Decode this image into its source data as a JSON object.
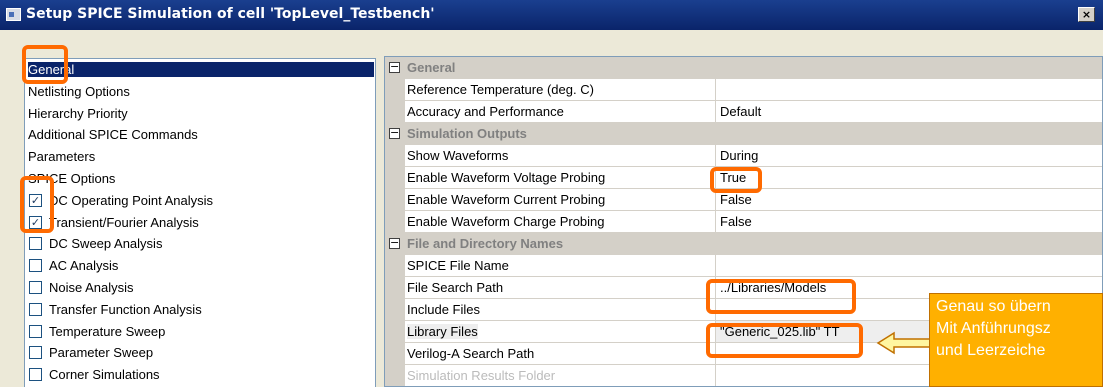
{
  "window": {
    "title": "Setup SPICE Simulation of cell 'TopLevel_Testbench'",
    "close_label": "×"
  },
  "nav": {
    "items": [
      {
        "label": "General",
        "selected": true
      },
      {
        "label": "Netlisting Options"
      },
      {
        "label": "Hierarchy Priority"
      },
      {
        "label": "Additional SPICE Commands"
      },
      {
        "label": "Parameters"
      },
      {
        "label": "SPICE Options"
      },
      {
        "label": "DC Operating Point Analysis",
        "checked": true
      },
      {
        "label": "Transient/Fourier Analysis",
        "checked": true
      },
      {
        "label": "DC Sweep Analysis",
        "checked": false
      },
      {
        "label": "AC Analysis",
        "checked": false
      },
      {
        "label": "Noise Analysis",
        "checked": false
      },
      {
        "label": "Transfer Function Analysis",
        "checked": false
      },
      {
        "label": "Temperature Sweep",
        "checked": false
      },
      {
        "label": "Parameter Sweep",
        "checked": false
      },
      {
        "label": "Corner Simulations",
        "checked": false
      }
    ]
  },
  "properties": {
    "rows": [
      {
        "type": "category",
        "name": "General"
      },
      {
        "type": "prop",
        "name": "Reference Temperature (deg. C)",
        "value": ""
      },
      {
        "type": "prop",
        "name": "Accuracy and Performance",
        "value": "Default"
      },
      {
        "type": "category",
        "name": "Simulation Outputs"
      },
      {
        "type": "prop",
        "name": "Show Waveforms",
        "value": "During"
      },
      {
        "type": "prop",
        "name": "Enable Waveform Voltage Probing",
        "value": "True"
      },
      {
        "type": "prop",
        "name": "Enable Waveform Current Probing",
        "value": "False"
      },
      {
        "type": "prop",
        "name": "Enable Waveform Charge Probing",
        "value": "False"
      },
      {
        "type": "category",
        "name": "File and Directory Names"
      },
      {
        "type": "prop",
        "name": "SPICE File Name",
        "value": ""
      },
      {
        "type": "prop",
        "name": "File Search Path",
        "value": "../Libraries/Models"
      },
      {
        "type": "prop",
        "name": "Include Files",
        "value": ""
      },
      {
        "type": "prop",
        "name": "Library Files",
        "value": "\"Generic_025.lib\" TT",
        "selected": true
      },
      {
        "type": "prop",
        "name": "Verilog-A Search Path",
        "value": ""
      },
      {
        "type": "prop",
        "name": "Simulation Results Folder",
        "value": "",
        "faded": true
      }
    ]
  },
  "callout": {
    "lines": [
      "Genau so übern",
      "Mit Anführungsz",
      "und Leerzeiche"
    ]
  }
}
